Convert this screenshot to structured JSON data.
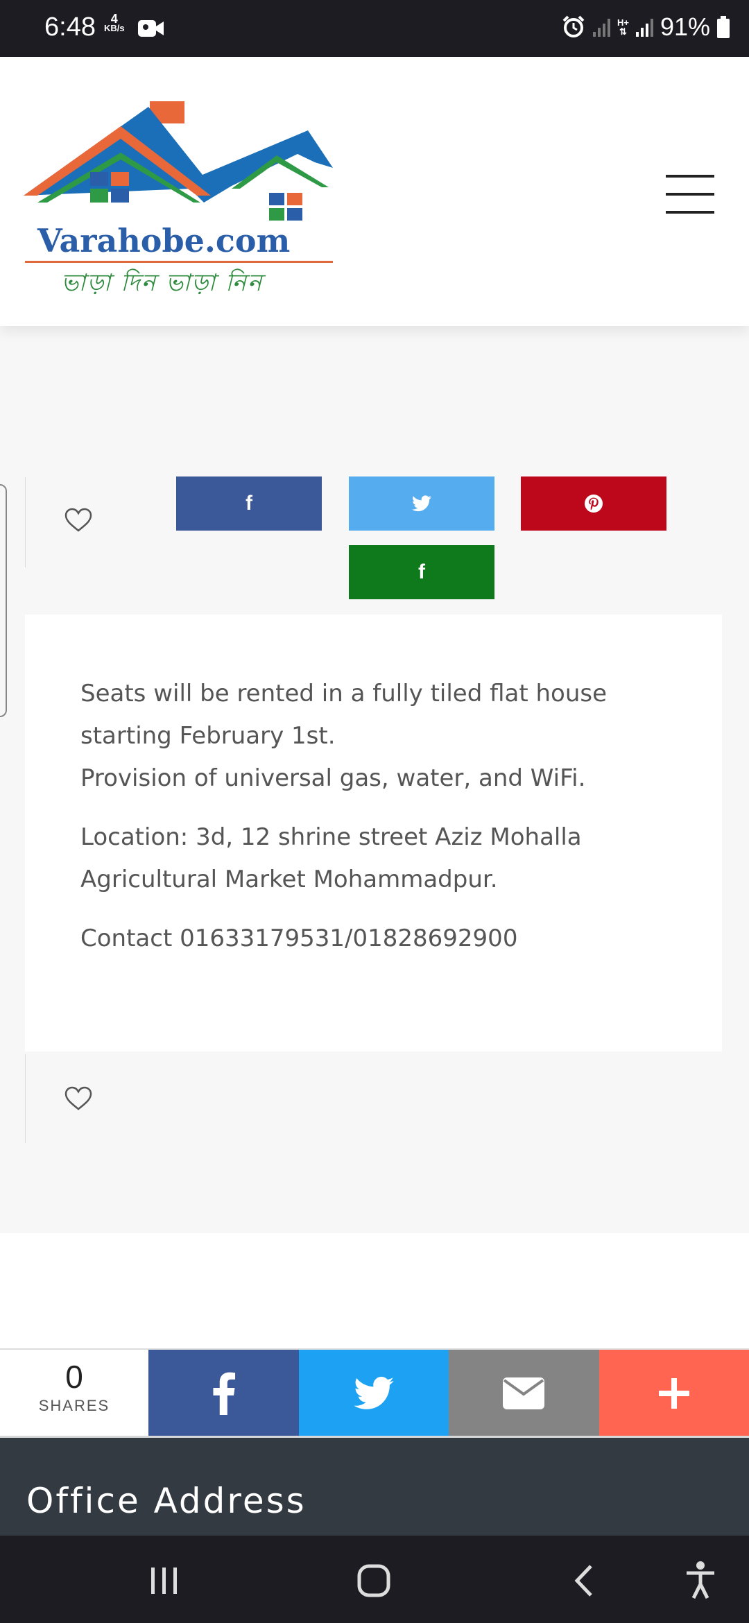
{
  "status_bar": {
    "time": "6:48",
    "speed_value": "4",
    "speed_unit": "KB/s",
    "network_type": "H+",
    "battery": "91%"
  },
  "header": {
    "logo_text": "Varahobe.com",
    "logo_tagline": "ভাড়া দিন ভাড়া নিন",
    "menu_icon": "hamburger-menu-icon"
  },
  "share_buttons": {
    "facebook_icon": "f",
    "twitter_icon": "twitter-bird-icon",
    "pinterest_icon": "pinterest-icon",
    "fourth_icon": "f",
    "colors": {
      "facebook": "#3b5998",
      "twitter": "#55acee",
      "pinterest": "#bd081c",
      "fourth": "#0e7a1c"
    }
  },
  "description": {
    "line1": "Seats will be rented in a fully tiled flat house starting February 1st.",
    "line2": "Provision of universal gas, water, and WiFi.",
    "location": "Location: 3d, 12 shrine street Aziz Mohalla Agricultural Market Mohammadpur.",
    "contact": "Contact 01633179531/01828692900"
  },
  "share_bar": {
    "count": "0",
    "label": "SHARES",
    "colors": {
      "facebook": "#3b5998",
      "twitter": "#1da1f2",
      "email": "#848484",
      "more": "#ff6550"
    }
  },
  "footer": {
    "title": "Office Address"
  }
}
